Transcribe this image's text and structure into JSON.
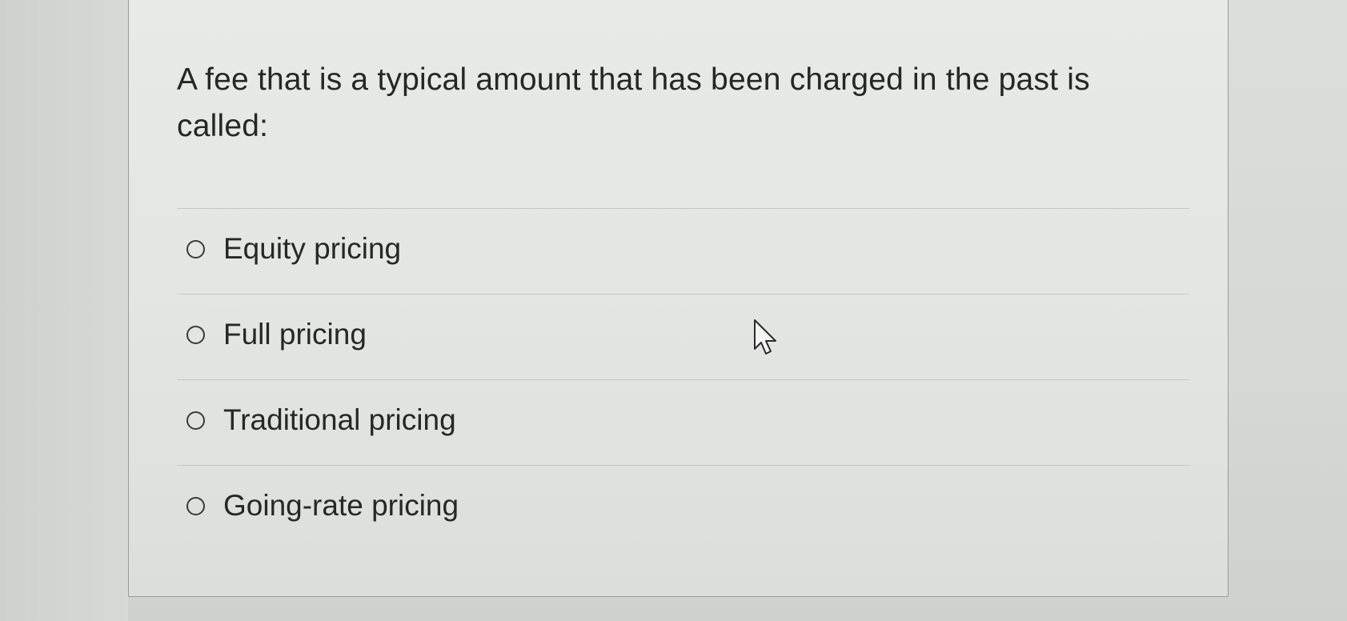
{
  "question": {
    "text": "A fee that is a typical amount that has been charged in the past is called:"
  },
  "options": [
    {
      "label": "Equity pricing",
      "selected": false
    },
    {
      "label": "Full pricing",
      "selected": false
    },
    {
      "label": "Traditional pricing",
      "selected": false
    },
    {
      "label": "Going-rate pricing",
      "selected": false
    }
  ],
  "icons": {
    "cursor": "mouse-pointer-icon",
    "radio": "radio-unchecked-icon"
  }
}
